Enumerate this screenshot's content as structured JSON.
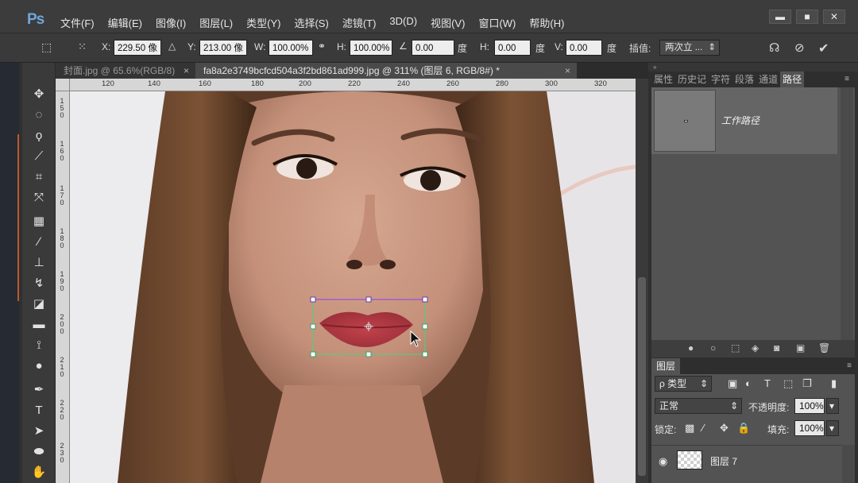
{
  "app": {
    "logo": "Ps",
    "menu": [
      "文件(F)",
      "编辑(E)",
      "图像(I)",
      "图层(L)",
      "类型(Y)",
      "选择(S)",
      "滤镜(T)",
      "3D(D)",
      "视图(V)",
      "窗口(W)",
      "帮助(H)"
    ],
    "window_buttons": [
      "▬",
      "■",
      "✕"
    ]
  },
  "options_bar": {
    "x_label": "X:",
    "x_value": "229.50 像",
    "y_label": "Y:",
    "y_value": "213.00 像",
    "w_label": "W:",
    "w_value": "100.00%",
    "h_label": "H:",
    "h_value": "100.00%",
    "angle_value": "0.00",
    "angle_unit": "度",
    "hskew_label": "H:",
    "hskew_value": "0.00",
    "hskew_unit": "度",
    "vskew_label": "V:",
    "vskew_value": "0.00",
    "vskew_unit": "度",
    "interp_label": "插值:",
    "interp_value": "两次立 ...",
    "commit_icon": "check-icon",
    "cancel_icon": "cancel-icon",
    "warp_icon": "warp-icon"
  },
  "documents": {
    "tab1": "封面.jpg @ 65.6%(RGB/8)",
    "tab1_close": "×",
    "tab2": "fa8a2e3749bcfcd504a3f2bd861ad999.jpg @ 311% (图层 6, RGB/8#) *",
    "tab2_close": "×"
  },
  "ruler": {
    "top_ticks": [
      "120",
      "140",
      "160",
      "180",
      "200",
      "220",
      "240",
      "260",
      "280",
      "300",
      "320"
    ],
    "left_ticks": [
      "150",
      "160",
      "170",
      "180",
      "190",
      "200",
      "210",
      "220",
      "230"
    ]
  },
  "panels": {
    "top_tabs": [
      "属性",
      "历史记",
      "字符",
      "段落",
      "通道",
      "路径"
    ],
    "active_top_tab": "路径",
    "path_name": "工作路径",
    "layers_tab": "图层",
    "filter_kind": "ρ 类型",
    "blend_mode": "正常",
    "opacity_label": "不透明度:",
    "opacity_value": "100%",
    "lock_label": "锁定:",
    "fill_label": "填充:",
    "fill_value": "100%",
    "layer_name": "图层 7"
  }
}
